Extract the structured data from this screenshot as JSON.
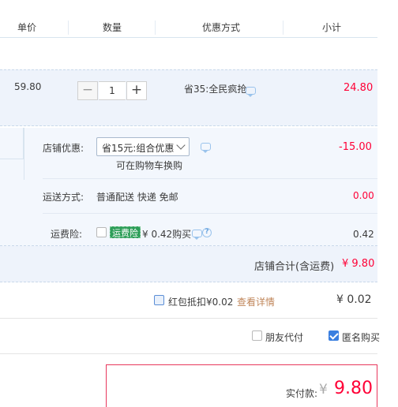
{
  "header": {
    "unit_price": "单价",
    "quantity": "数量",
    "discount_method": "优惠方式",
    "subtotal": "小计"
  },
  "item": {
    "unit_price": "59.80",
    "quantity": "1",
    "minus_label": "−",
    "plus_label": "+",
    "promotion": "省35:全民疯抢",
    "subtotal": "24.80"
  },
  "shop": {
    "discount_label": "店铺优惠:",
    "discount_selected": "省15元:组合优惠",
    "discount_hint": "可在购物车换购",
    "discount_amount": "-15.00",
    "shipping_label": "运送方式:",
    "shipping_method": "普通配送 快递 免邮",
    "shipping_amount": "0.00",
    "insurance_label": "运费险:",
    "insurance_tag": "运费险",
    "insurance_price": "¥ 0.42购买",
    "insurance_amount": "0.42",
    "total_label": "店铺合计(含运费)",
    "total_amount": "¥ 9.80"
  },
  "red_packet": {
    "label": "红包抵扣¥0.02",
    "details_link": "查看详情",
    "amount": "¥ 0.02"
  },
  "options": {
    "friend_pay": "朋友代付",
    "anonymous": "匿名购买",
    "anonymous_checked": true,
    "friend_pay_checked": false
  },
  "payment": {
    "label": "实付款:",
    "currency": "¥",
    "amount": "9.80"
  },
  "colors": {
    "accent_red": "#ff0036",
    "price_red": "#ff4400",
    "row_bg": "#eef3fb",
    "checkbox_blue": "#3b7fe0",
    "insurance_green": "#2e9e59"
  }
}
